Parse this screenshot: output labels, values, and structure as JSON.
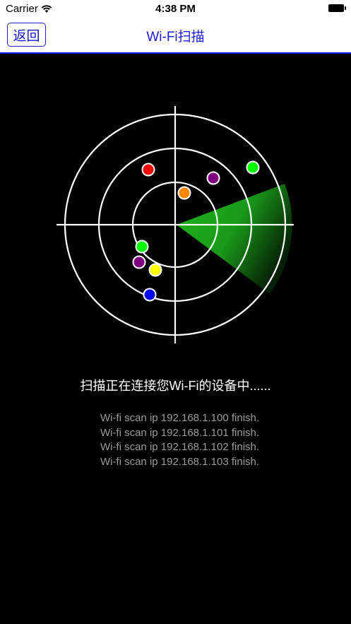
{
  "status_bar": {
    "carrier": "Carrier",
    "time": "4:38 PM",
    "icons": [
      "wifi-icon",
      "battery-icon"
    ]
  },
  "nav": {
    "back_label": "返回",
    "title": "Wi-Fi扫描",
    "accent_color": "#1b1be0"
  },
  "radar": {
    "sweep_color": "#22cc22",
    "devices": [
      {
        "color": "#ff0000"
      },
      {
        "color": "#800080"
      },
      {
        "color": "#00ff00"
      },
      {
        "color": "#ff8800"
      },
      {
        "color": "#00ff00"
      },
      {
        "color": "#800080"
      },
      {
        "color": "#ffff00"
      },
      {
        "color": "#0000ff"
      }
    ]
  },
  "scan": {
    "message": "扫描正在连接您Wi-Fi的设备中......",
    "log": [
      "Wi-fi scan ip 192.168.1.100 finish.",
      "Wi-fi scan ip 192.168.1.101 finish.",
      "Wi-fi scan ip 192.168.1.102 finish.",
      "Wi-fi scan ip 192.168.1.103 finish."
    ]
  }
}
